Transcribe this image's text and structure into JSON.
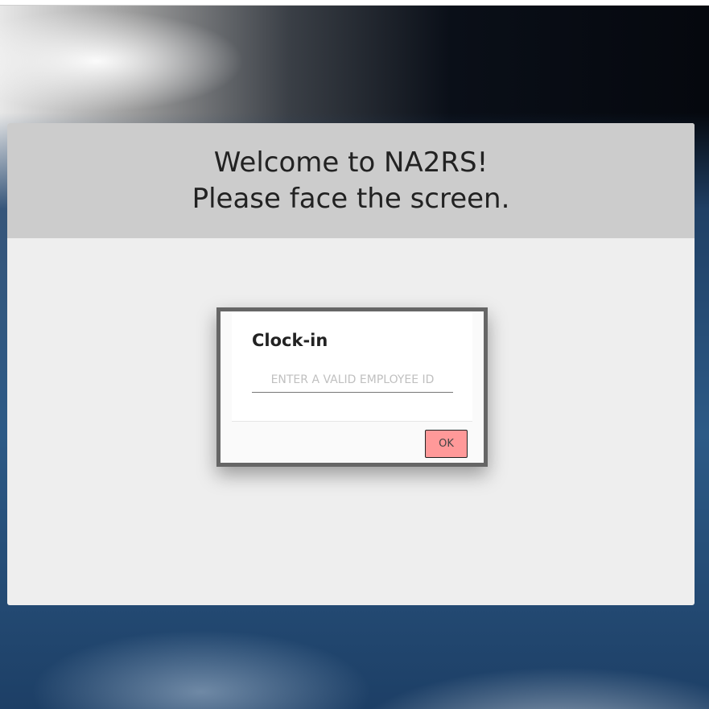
{
  "header": {
    "line1": "Welcome to NA2RS!",
    "line2": "Please face the screen."
  },
  "dialog": {
    "title": "Clock-in",
    "employee_id": {
      "value": "",
      "placeholder": "ENTER A VALID EMPLOYEE ID"
    },
    "ok_label": "OK"
  },
  "colors": {
    "header_bg": "#cccccc",
    "card_bg": "#eeeeee",
    "ok_button_bg": "#ff9999",
    "dialog_border": "#666666"
  }
}
